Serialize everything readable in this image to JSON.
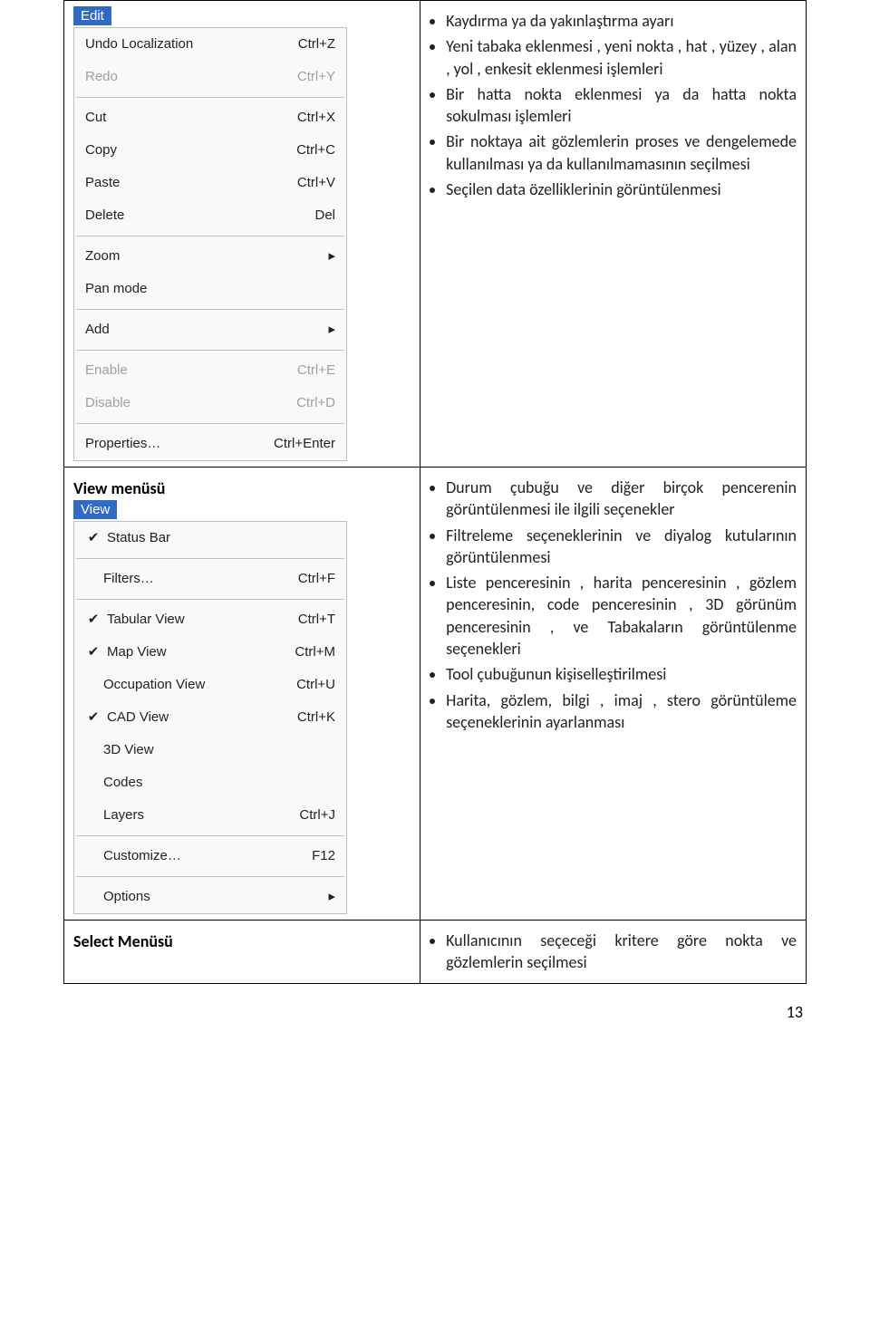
{
  "row1": {
    "edit": {
      "header": "Edit",
      "items": [
        {
          "label": "Undo Localization",
          "shortcut": "Ctrl+Z",
          "disabled": false,
          "sub": false,
          "check": false
        },
        {
          "label": "Redo",
          "shortcut": "Ctrl+Y",
          "disabled": true,
          "sub": false,
          "check": false
        },
        {
          "sep": true
        },
        {
          "label": "Cut",
          "shortcut": "Ctrl+X",
          "disabled": false,
          "sub": false,
          "check": false
        },
        {
          "label": "Copy",
          "shortcut": "Ctrl+C",
          "disabled": false,
          "sub": false,
          "check": false
        },
        {
          "label": "Paste",
          "shortcut": "Ctrl+V",
          "disabled": false,
          "sub": false,
          "check": false
        },
        {
          "label": "Delete",
          "shortcut": "Del",
          "disabled": false,
          "sub": false,
          "check": false
        },
        {
          "sep": true
        },
        {
          "label": "Zoom",
          "shortcut": "",
          "disabled": false,
          "sub": true,
          "check": false
        },
        {
          "label": "Pan mode",
          "shortcut": "",
          "disabled": false,
          "sub": false,
          "check": false
        },
        {
          "sep": true
        },
        {
          "label": "Add",
          "shortcut": "",
          "disabled": false,
          "sub": true,
          "check": false
        },
        {
          "sep": true
        },
        {
          "label": "Enable",
          "shortcut": "Ctrl+E",
          "disabled": true,
          "sub": false,
          "check": false
        },
        {
          "label": "Disable",
          "shortcut": "Ctrl+D",
          "disabled": true,
          "sub": false,
          "check": false
        },
        {
          "sep": true
        },
        {
          "label": "Properties…",
          "shortcut": "Ctrl+Enter",
          "disabled": false,
          "sub": false,
          "check": false
        }
      ]
    },
    "bullets": [
      "Kaydırma ya da yakınlaştırma ayarı",
      "Yeni tabaka eklenmesi , yeni nokta , hat , yüzey , alan , yol , enkesit eklenmesi işlemleri",
      "Bir hatta nokta eklenmesi ya da hatta nokta sokulması işlemleri",
      "Bir noktaya ait gözlemlerin proses ve dengelemede kullanılması ya da kullanılmamasının seçilmesi",
      "Seçilen data özelliklerinin görüntülenmesi"
    ]
  },
  "row2": {
    "title": "View  menüsü",
    "view": {
      "header": "View",
      "items": [
        {
          "label": "Status Bar",
          "shortcut": "",
          "disabled": false,
          "sub": false,
          "check": true
        },
        {
          "sep": true
        },
        {
          "label": "Filters…",
          "shortcut": "Ctrl+F",
          "disabled": false,
          "sub": false,
          "check": false,
          "indent": true
        },
        {
          "sep": true
        },
        {
          "label": "Tabular View",
          "shortcut": "Ctrl+T",
          "disabled": false,
          "sub": false,
          "check": true
        },
        {
          "label": "Map View",
          "shortcut": "Ctrl+M",
          "disabled": false,
          "sub": false,
          "check": true
        },
        {
          "label": "Occupation View",
          "shortcut": "Ctrl+U",
          "disabled": false,
          "sub": false,
          "check": false,
          "indent": true
        },
        {
          "label": "CAD View",
          "shortcut": "Ctrl+K",
          "disabled": false,
          "sub": false,
          "check": true
        },
        {
          "label": "3D View",
          "shortcut": "",
          "disabled": false,
          "sub": false,
          "check": false,
          "indent": true
        },
        {
          "label": "Codes",
          "shortcut": "",
          "disabled": false,
          "sub": false,
          "check": false,
          "indent": true
        },
        {
          "label": "Layers",
          "shortcut": "Ctrl+J",
          "disabled": false,
          "sub": false,
          "check": false,
          "indent": true
        },
        {
          "sep": true
        },
        {
          "label": "Customize…",
          "shortcut": "F12",
          "disabled": false,
          "sub": false,
          "check": false,
          "indent": true
        },
        {
          "sep": true
        },
        {
          "label": "Options",
          "shortcut": "",
          "disabled": false,
          "sub": true,
          "check": false,
          "indent": true
        }
      ]
    },
    "bullets": [
      "Durum çubuğu ve diğer birçok pencerenin görüntülenmesi ile ilgili seçenekler",
      "Filtreleme seçeneklerinin ve diyalog kutularının görüntülenmesi",
      "Liste penceresinin , harita penceresinin , gözlem penceresinin, code penceresinin , 3D görünüm penceresinin , ve Tabakaların görüntülenme seçenekleri",
      "Tool çubuğunun kişiselleştirilmesi",
      "Harita, gözlem, bilgi , imaj , stero görüntüleme seçeneklerinin ayarlanması"
    ]
  },
  "row3": {
    "title": "Select Menüsü",
    "bullets": [
      "Kullanıcının seçeceği kritere göre nokta ve  gözlemlerin seçilmesi"
    ]
  },
  "page_number": "13"
}
